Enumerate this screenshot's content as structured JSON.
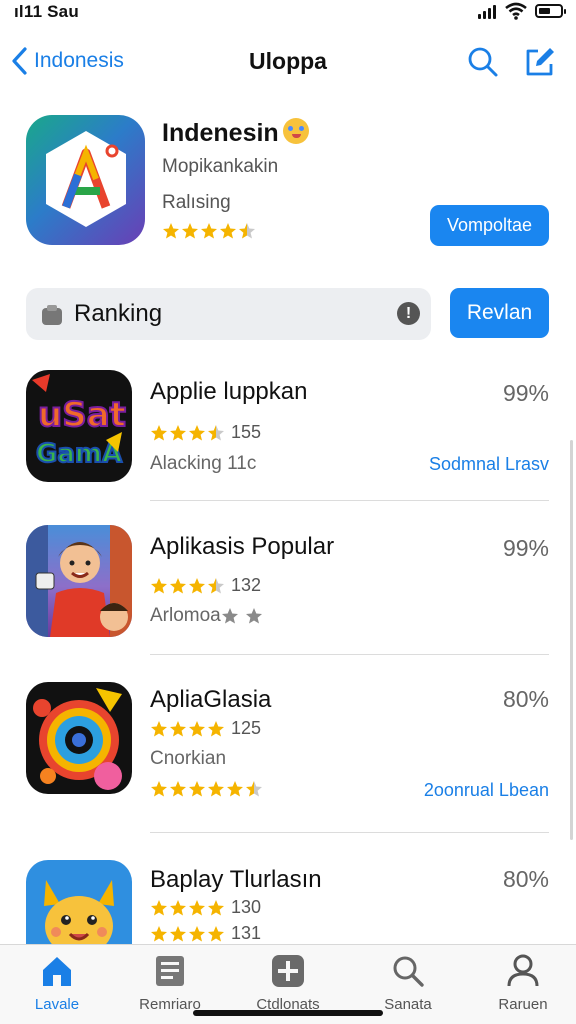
{
  "status_bar": {
    "time": "ıl11 Sau",
    "battery_level": 0.55
  },
  "nav": {
    "back_label": "Indonesis",
    "title": "Uloppa"
  },
  "featured": {
    "title": "Indenesin",
    "subtitle": "Mopikankakin",
    "rating_label": "Ralısing",
    "stars": 4.5,
    "button_label": "Vompoltae",
    "accent": "#1a86f0"
  },
  "ranking": {
    "label": "Ranking",
    "info": "!",
    "button_label": "Revlan"
  },
  "apps": [
    {
      "name": "Applie luppkan",
      "percent": "99%",
      "stars": 3.5,
      "count": "155",
      "subtitle": "Alacking 11c",
      "link": "Sodmnal Lrasv",
      "icon": "game-logo-icon"
    },
    {
      "name": "Aplikasis Popular",
      "percent": "99%",
      "stars": 3.5,
      "count": "132",
      "subtitle": "Arlomoa",
      "link": "",
      "icon": "cartoon-boy-icon"
    },
    {
      "name": "ApliaGlasia",
      "percent": "80%",
      "stars": 4,
      "count": "125",
      "subtitle": "Cnorkian",
      "link": "2oonrual Lbean",
      "icon": "colorful-circle-icon"
    },
    {
      "name": "Baplay Tlurlasın",
      "percent": "80%",
      "stars": 4,
      "count": "130",
      "subtitle": "",
      "link": "",
      "icon": "yellow-creature-icon",
      "count2": "131"
    }
  ],
  "tabs": [
    {
      "label": "Lavale",
      "icon": "home-icon",
      "active": true
    },
    {
      "label": "Remriaro",
      "icon": "list-icon",
      "active": false
    },
    {
      "label": "Ctdlonats",
      "icon": "plus-icon",
      "active": false
    },
    {
      "label": "Sanata",
      "icon": "search-icon",
      "active": false
    },
    {
      "label": "Raruen",
      "icon": "person-icon",
      "active": false
    }
  ],
  "colors": {
    "accent": "#1a86f0",
    "link": "#1a7fe6",
    "star": "#f5b400"
  }
}
